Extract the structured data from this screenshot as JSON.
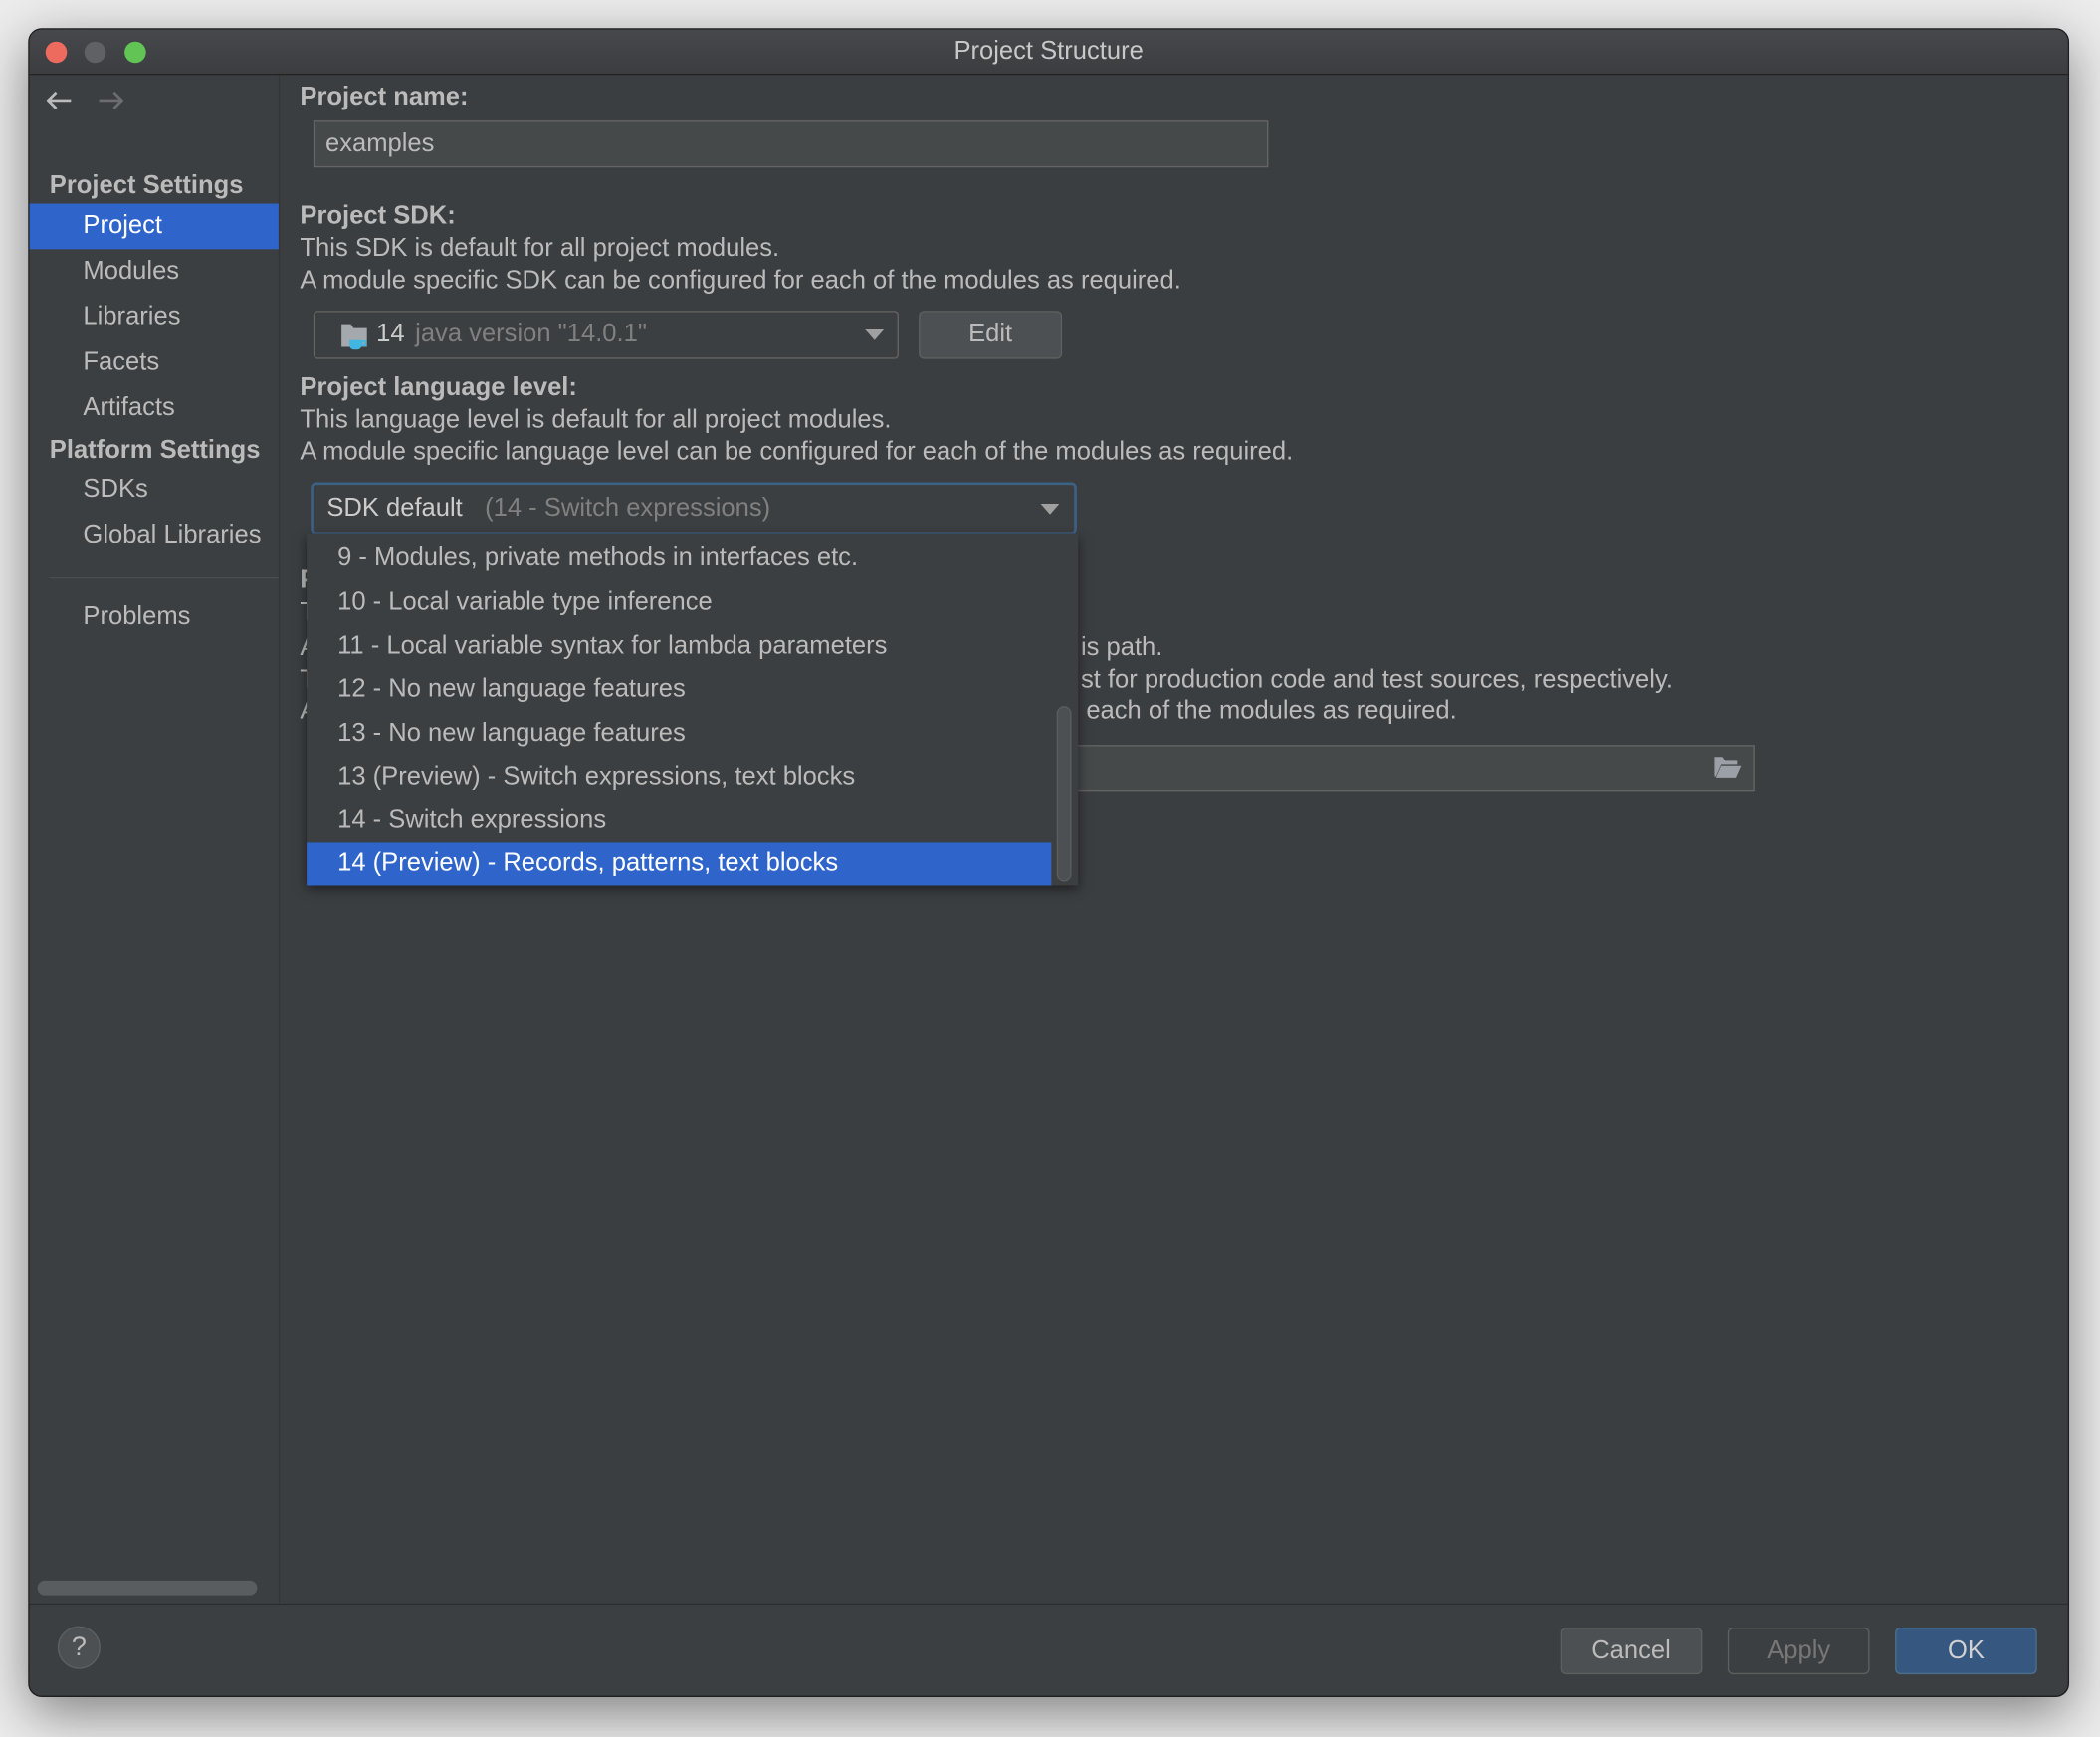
{
  "window": {
    "title": "Project Structure"
  },
  "colors": {
    "selection": "#2f65ca",
    "focus_border": "#3d6185",
    "ok_button": "#365880",
    "close": "#ed6a5e",
    "minimize": "#5f6164",
    "maximize": "#61c454"
  },
  "sidebar": {
    "nav_back_icon": "arrow-left-icon",
    "nav_forward_icon": "arrow-right-icon",
    "project_settings_header": "Project Settings",
    "project_items": [
      {
        "label": "Project",
        "selected": true
      },
      {
        "label": "Modules"
      },
      {
        "label": "Libraries"
      },
      {
        "label": "Facets"
      },
      {
        "label": "Artifacts"
      }
    ],
    "platform_settings_header": "Platform Settings",
    "platform_items": [
      {
        "label": "SDKs"
      },
      {
        "label": "Global Libraries"
      }
    ],
    "problems": "Problems"
  },
  "main": {
    "project_name_label": "Project name:",
    "project_name_value": "examples",
    "sdk_label": "Project SDK:",
    "sdk_desc1": "This SDK is default for all project modules.",
    "sdk_desc2": "A module specific SDK can be configured for each of the modules as required.",
    "sdk_selected_version": "14",
    "sdk_selected_detail": "java version \"14.0.1\"",
    "sdk_icon": "jdk-folder-icon",
    "edit_button": "Edit",
    "lang_label": "Project language level:",
    "lang_desc1": "This language level is default for all project modules.",
    "lang_desc2": "A module specific language level can be configured for each of the modules as required.",
    "lang_selected": "SDK default",
    "lang_selected_detail": "(14 - Switch expressions)",
    "lang_options": [
      {
        "label": "9 - Modules, private methods in interfaces etc."
      },
      {
        "label": "10 - Local variable type inference"
      },
      {
        "label": "11 - Local variable syntax for lambda parameters"
      },
      {
        "label": "12 - No new language features"
      },
      {
        "label": "13 - No new language features"
      },
      {
        "label": "13 (Preview) - Switch expressions, text blocks"
      },
      {
        "label": "14 - Switch expressions"
      },
      {
        "label": "14 (Preview) - Records, patterns, text blocks",
        "highlighted": true
      }
    ],
    "compiler_fragments": {
      "heading_initial": "P",
      "line1_initial": "T",
      "line2_initial": "A",
      "line2_tail": "is path.",
      "line3_initial": "T",
      "line3_tail": "st for production code and test sources, respectively.",
      "line4_initial": "A",
      "line4_tail": "each of the modules as required."
    }
  },
  "footer": {
    "help": "?",
    "cancel": "Cancel",
    "apply": "Apply",
    "ok": "OK"
  }
}
